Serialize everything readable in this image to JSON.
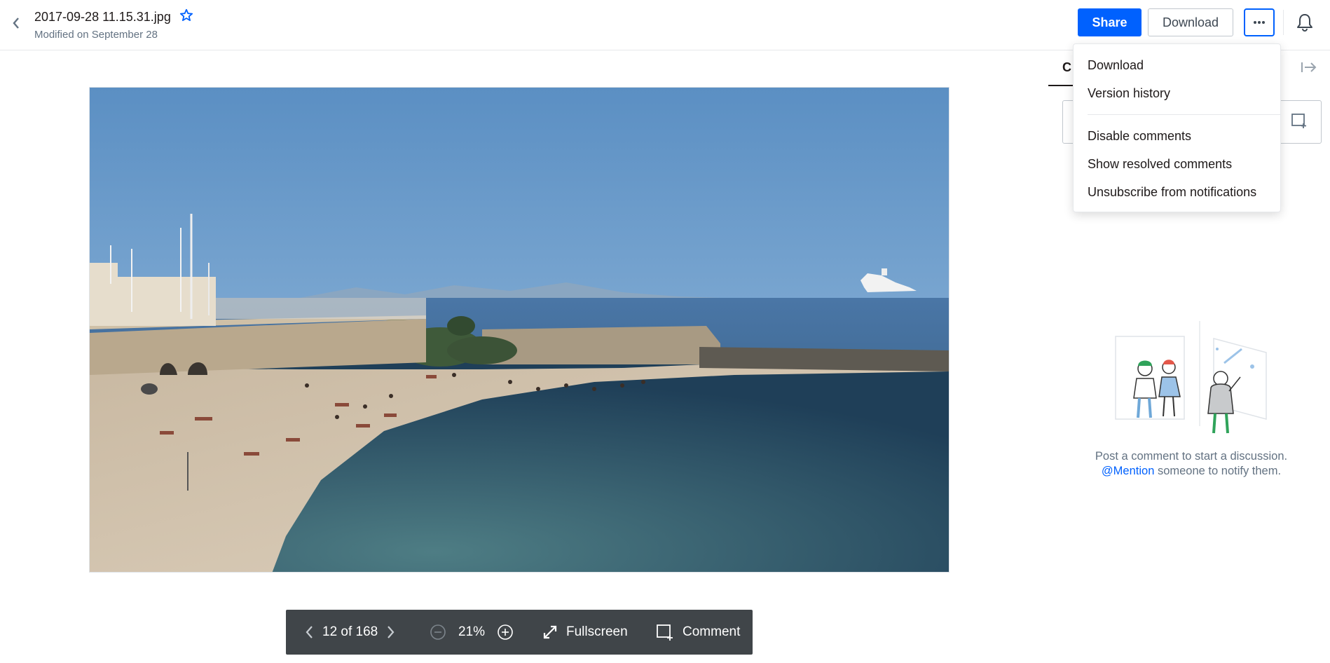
{
  "header": {
    "file_name": "2017-09-28 11.15.31.jpg",
    "modified": "Modified on September 28",
    "share_label": "Share",
    "download_label": "Download"
  },
  "menu": {
    "items": [
      "Download",
      "Version history",
      "Disable comments",
      "Show resolved comments",
      "Unsubscribe from notifications"
    ]
  },
  "sidebar": {
    "tab_label": "C",
    "empty_line1": "Post a comment to start a discussion.",
    "mention": "@Mention",
    "empty_line2_rest": " someone to notify them."
  },
  "toolbar": {
    "page": "12 of 168",
    "zoom": "21%",
    "fullscreen_label": "Fullscreen",
    "comment_label": "Comment"
  },
  "colors": {
    "accent": "#0061fe",
    "toolbar_bg": "#404549",
    "muted_text": "#637282"
  }
}
